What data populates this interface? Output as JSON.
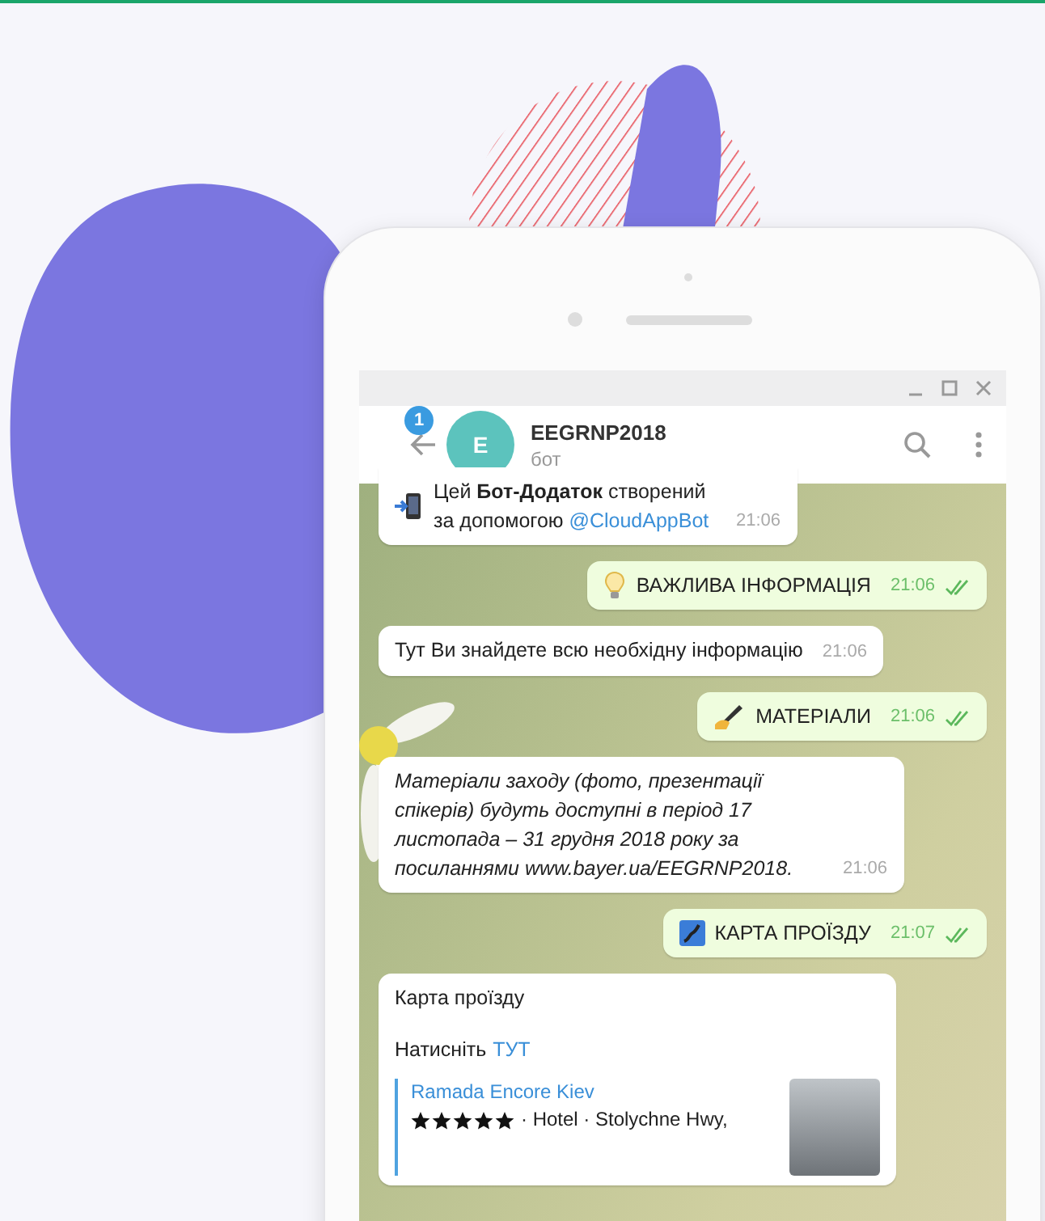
{
  "chat_header": {
    "unread_badge": "1",
    "avatar_letter": "E",
    "title": "EEGRNP2018",
    "subtitle": "бот"
  },
  "messages": [
    {
      "kind": "text",
      "outgoing": false,
      "text": "Цей **Бот-Додаток** створений за допомогою",
      "link": "@CloudAppBot",
      "time": "21:06"
    },
    {
      "kind": "text",
      "outgoing": true,
      "text": "ВАЖЛИВА ІНФОРМАЦІЯ",
      "time": "21:06",
      "read": true
    },
    {
      "kind": "text",
      "outgoing": false,
      "text": "Тут Ви знайдете всю необхідну інформацію",
      "time": "21:06"
    },
    {
      "kind": "text",
      "outgoing": true,
      "text": "МАТЕРІАЛИ",
      "time": "21:06",
      "read": true
    },
    {
      "kind": "italic",
      "outgoing": false,
      "text": "Матеріали  заходу (фото, презентації спікерів) будуть доступні в період 17 листопада  – 31 грудня 2018 року за посиланнями www.bayer.ua/EEGRNP2018.",
      "time": "21:06"
    },
    {
      "kind": "text",
      "outgoing": true,
      "text": "КАРТА ПРОЇЗДУ",
      "time": "21:07",
      "read": true
    },
    {
      "kind": "card",
      "outgoing": false,
      "text": "Карта проїзду",
      "prompt": "Натисніть",
      "link": "ТУТ",
      "preview": {
        "title": "Ramada Encore Kiev",
        "stars": 5,
        "detail": "· Hotel · Stolychne Hwy,"
      }
    }
  ]
}
